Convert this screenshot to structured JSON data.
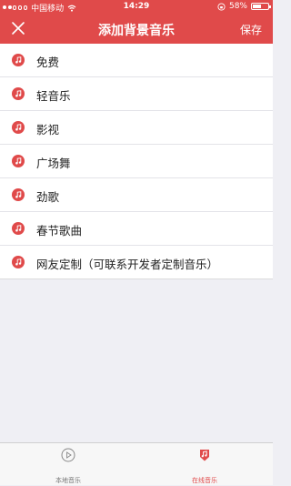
{
  "status": {
    "carrier": "中国移动",
    "time": "14:29",
    "battery": "58%",
    "battery_level": 0.58
  },
  "nav": {
    "title": "添加背景音乐",
    "save": "保存"
  },
  "categories": [
    {
      "label": "免费"
    },
    {
      "label": "轻音乐"
    },
    {
      "label": "影视"
    },
    {
      "label": "广场舞"
    },
    {
      "label": "劲歌"
    },
    {
      "label": "春节歌曲"
    },
    {
      "label": "网友定制（可联系开发者定制音乐）"
    }
  ],
  "tabs": {
    "local": "本地音乐",
    "online": "在线音乐"
  },
  "colors": {
    "accent": "#e04a4a"
  },
  "icons": {
    "close": "close-icon",
    "note": "music-note-icon",
    "local": "play-circle-icon",
    "online": "online-music-icon"
  }
}
